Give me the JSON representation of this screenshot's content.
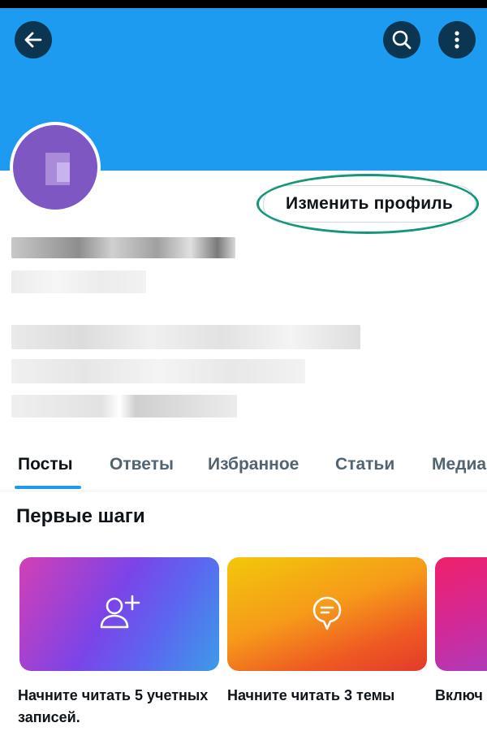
{
  "header": {
    "back_icon": "arrow-left-icon",
    "search_icon": "search-icon",
    "more_icon": "more-vertical-icon"
  },
  "profile": {
    "edit_button_label": "Изменить профиль"
  },
  "tabs": [
    {
      "label": "Посты",
      "active": true
    },
    {
      "label": "Ответы",
      "active": false
    },
    {
      "label": "Избранное",
      "active": false
    },
    {
      "label": "Статьи",
      "active": false
    },
    {
      "label": "Медиа",
      "active": false
    }
  ],
  "first_steps": {
    "title": "Первые шаги",
    "cards": [
      {
        "caption": "Начните читать 5 учетных записей.",
        "icon": "add-user-icon"
      },
      {
        "caption": "Начните читать 3 темы",
        "icon": "topic-bubble-icon"
      },
      {
        "caption": "Включ",
        "icon": ""
      }
    ]
  },
  "colors": {
    "accent": "#1d9bf0",
    "highlight": "#14967a",
    "header_button": "#0b3550"
  }
}
